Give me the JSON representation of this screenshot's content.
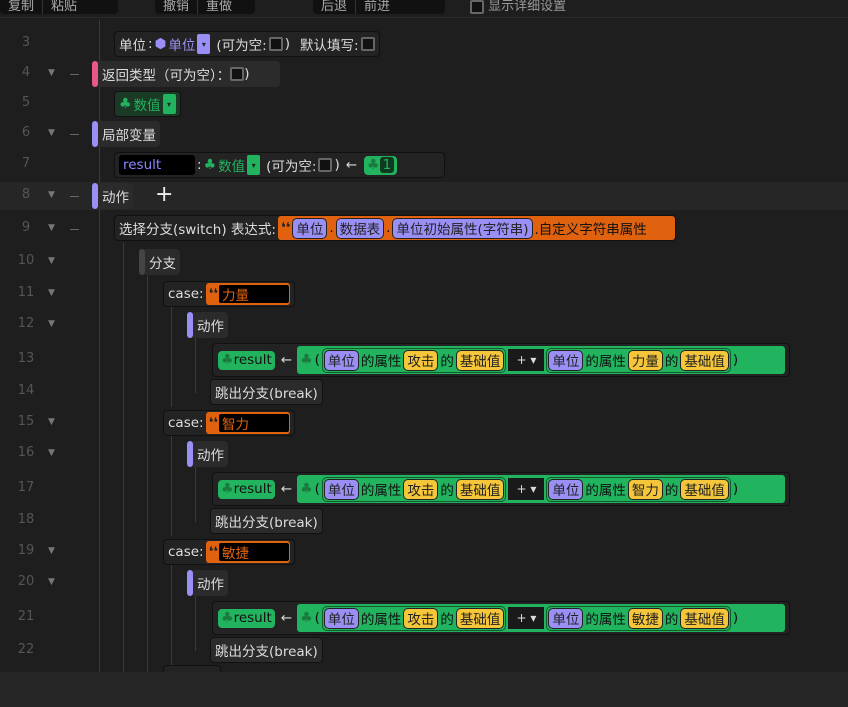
{
  "toolbar": {
    "copy": "复制",
    "paste": "粘贴",
    "undo": "撤销",
    "redo": "重做",
    "back": "后退",
    "forward": "前进",
    "show_details": "显示详细设置"
  },
  "lines": [
    "3",
    "4",
    "5",
    "6",
    "7",
    "8",
    "9",
    "10",
    "11",
    "12",
    "13",
    "14",
    "15",
    "16",
    "17",
    "18",
    "19",
    "20",
    "21",
    "22"
  ],
  "param": {
    "name": "单位",
    "sep": ":",
    "type": "单位",
    "nullable": "(可为空:",
    "close": ")",
    "default": "默认填写:"
  },
  "return": {
    "label": "返回类型（可为空）：",
    "close": ")",
    "type": "数值"
  },
  "locals": {
    "label": "局部变量",
    "var_name": "result",
    "sep": ":",
    "type": "数值",
    "nullable": "(可为空:",
    "close": ")",
    "arrow": "←",
    "init": "1"
  },
  "actions": {
    "label": "动作",
    "add": "+"
  },
  "switch": {
    "label": "选择分支(switch) 表达式:",
    "p1": "单位",
    "p2": "数据表",
    "p3": "单位初始属性(字符串)",
    "suffix": ".自定义字符串属性",
    "dot": "."
  },
  "branch": {
    "label": "分支"
  },
  "cases": [
    {
      "case_label": "case:",
      "value": "力量",
      "action": "动作",
      "var": "result",
      "arrow": "←",
      "open": "(",
      "unit1": "单位",
      "prop_of": "的属性",
      "attr1": "攻击",
      "of": "的",
      "base": "基础值",
      "op": "+",
      "unit2": "单位",
      "attr2": "力量",
      "close": ")",
      "break": "跳出分支(break)"
    },
    {
      "case_label": "case:",
      "value": "智力",
      "action": "动作",
      "var": "result",
      "arrow": "←",
      "open": "(",
      "unit1": "单位",
      "prop_of": "的属性",
      "attr1": "攻击",
      "of": "的",
      "base": "基础值",
      "op": "+",
      "unit2": "单位",
      "attr2": "智力",
      "close": ")",
      "break": "跳出分支(break)"
    },
    {
      "case_label": "case:",
      "value": "敏捷",
      "action": "动作",
      "var": "result",
      "arrow": "←",
      "open": "(",
      "unit1": "单位",
      "prop_of": "的属性",
      "attr1": "攻击",
      "of": "的",
      "base": "基础值",
      "op": "+",
      "unit2": "单位",
      "attr2": "敏捷",
      "close": ")",
      "break": "跳出分支(break)"
    }
  ],
  "colors": {
    "bg": "#1e1e1e",
    "purple": "#9a8ff5",
    "green": "#22b35e",
    "yellow": "#f5c53a",
    "orange": "#e0620e",
    "pink": "#e8578a"
  }
}
